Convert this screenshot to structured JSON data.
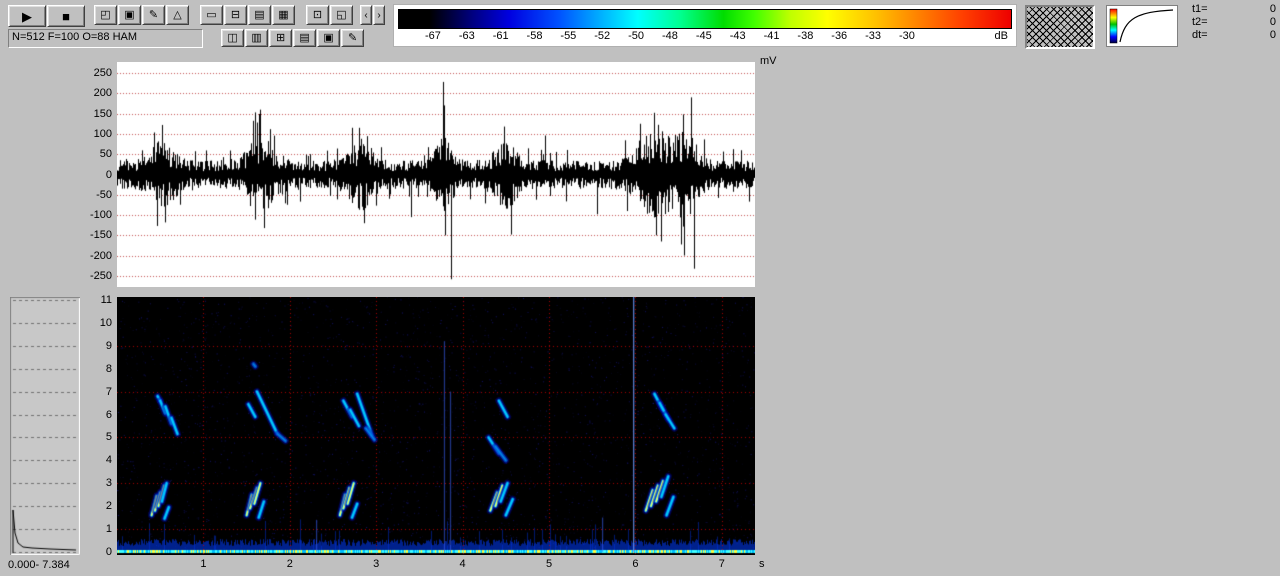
{
  "colors": {
    "background": "#c0c0c0",
    "grid_red": "#b43c3c",
    "spectro_grid": "#b40000",
    "accent_black": "#000000"
  },
  "toolbar": {
    "status_field": "N=512 F=100 O=88 HAM",
    "row1": [
      {
        "name": "play-button",
        "icon": "play-icon",
        "glyph": "▶",
        "big": true
      },
      {
        "name": "stop-button",
        "icon": "stop-icon",
        "glyph": "■",
        "big": true
      },
      {
        "gap": 8
      },
      {
        "name": "cascade-windows-button",
        "icon": "cascade-windows-icon",
        "glyph": "◰"
      },
      {
        "name": "save-button",
        "icon": "save-icon",
        "glyph": "▣"
      },
      {
        "name": "edit-button",
        "icon": "pencil-icon",
        "glyph": "✎"
      },
      {
        "name": "display-mode-button",
        "icon": "triangle-icon",
        "glyph": "△"
      },
      {
        "gap": 10
      },
      {
        "name": "window-layout-1-button",
        "icon": "window-single-icon",
        "glyph": "▭"
      },
      {
        "name": "window-layout-2-button",
        "icon": "window-hsplit-icon",
        "glyph": "⊟"
      },
      {
        "name": "window-layout-3-button",
        "icon": "window-rows-icon",
        "glyph": "▤"
      },
      {
        "name": "window-layout-4-button",
        "icon": "window-grid-icon",
        "glyph": "▦"
      },
      {
        "gap": 10
      },
      {
        "name": "print-button",
        "icon": "printer-icon",
        "glyph": "⊡"
      },
      {
        "name": "open-file-button",
        "icon": "folder-open-icon",
        "glyph": "◱"
      },
      {
        "gap": 6
      },
      {
        "name": "scroll-left-button",
        "icon": "chevron-left-icon",
        "glyph": "‹",
        "narrow": true
      },
      {
        "name": "scroll-right-button",
        "icon": "chevron-right-icon",
        "glyph": "›",
        "narrow": true
      }
    ],
    "row2_buttons": [
      {
        "name": "view-layout-1-button",
        "icon": "window-vsplit-icon",
        "glyph": "◫"
      },
      {
        "name": "view-layout-2-button",
        "icon": "window-hrows-icon",
        "glyph": "▥"
      },
      {
        "name": "view-layout-3-button",
        "icon": "window-plus-icon",
        "glyph": "⊞"
      },
      {
        "name": "view-layout-4-button",
        "icon": "window-lines-icon",
        "glyph": "▤"
      },
      {
        "name": "view-layout-5-button",
        "icon": "window-boxed-icon",
        "glyph": "▣"
      },
      {
        "name": "annotate-button",
        "icon": "note-icon",
        "glyph": "✎"
      }
    ]
  },
  "db_scale": {
    "labels": [
      "-67",
      "-63",
      "-61",
      "-58",
      "-55",
      "-52",
      "-50",
      "-48",
      "-45",
      "-43",
      "-41",
      "-38",
      "-36",
      "-33",
      "-30"
    ],
    "unit": "dB"
  },
  "time_panel": {
    "rows": [
      {
        "label": "t1=",
        "value": "0"
      },
      {
        "label": "t2=",
        "value": "0"
      },
      {
        "label": "dt=",
        "value": "0"
      }
    ]
  },
  "waveform_panel": {
    "unit": "mV",
    "y_ticks": [
      "250",
      "200",
      "150",
      "100",
      "50",
      "0",
      "-50",
      "-100",
      "-150",
      "-200",
      "-250"
    ]
  },
  "spectrogram_panel": {
    "y_ticks": [
      "11",
      "10",
      "9",
      "8",
      "7",
      "6",
      "5",
      "4",
      "3",
      "2",
      "1",
      "0"
    ],
    "x_ticks": [
      "1",
      "2",
      "3",
      "4",
      "5",
      "6",
      "7"
    ],
    "x_unit": "s"
  },
  "spectrum_panel": {
    "range_label": "0.000- 7.384"
  },
  "chart_data": {
    "type": "heatmap",
    "title": "",
    "duration_s": 7.384,
    "oscillogram": {
      "unit": "mV",
      "ylim": [
        -260,
        260
      ],
      "base_amplitude_mV": 32,
      "bursts": [
        [
          0.52,
          45,
          0.12
        ],
        [
          1.66,
          55,
          0.15
        ],
        [
          2.82,
          50,
          0.12
        ],
        [
          3.78,
          55,
          0.08
        ],
        [
          4.5,
          45,
          0.12
        ],
        [
          6.25,
          70,
          0.18
        ],
        [
          6.6,
          60,
          0.1
        ]
      ],
      "spikes": [
        [
          3.77,
          228
        ],
        [
          3.86,
          -258
        ],
        [
          3.8,
          -150
        ],
        [
          0.52,
          122
        ],
        [
          0.56,
          -118
        ],
        [
          1.62,
          128
        ],
        [
          1.7,
          -132
        ],
        [
          2.8,
          115
        ],
        [
          2.86,
          -120
        ],
        [
          4.48,
          118
        ],
        [
          4.56,
          -148
        ],
        [
          6.05,
          125
        ],
        [
          6.22,
          152
        ],
        [
          6.3,
          -165
        ],
        [
          6.55,
          148
        ],
        [
          6.64,
          190
        ],
        [
          6.68,
          -232
        ],
        [
          3.4,
          -105
        ],
        [
          4.95,
          96
        ],
        [
          5.55,
          -98
        ],
        [
          5.9,
          -90
        ]
      ]
    },
    "spectrogram": {
      "f_max_khz": 11,
      "noise_floor_khz": 0.4,
      "grid": {
        "x_every_s": 1,
        "y_lines_khz": [
          1,
          3,
          5,
          7,
          9
        ]
      },
      "strokes": [
        [
          0.47,
          6.8,
          0.5,
          6.6,
          1
        ],
        [
          0.5,
          6.6,
          0.56,
          6.05,
          1
        ],
        [
          0.56,
          6.35,
          0.63,
          5.6,
          1
        ],
        [
          0.63,
          5.85,
          0.7,
          5.15,
          1
        ],
        [
          0.4,
          1.6,
          0.46,
          2.45,
          2
        ],
        [
          0.44,
          1.8,
          0.5,
          2.6,
          2
        ],
        [
          0.48,
          2.0,
          0.545,
          2.9,
          2
        ],
        [
          0.52,
          2.2,
          0.575,
          3.0,
          1
        ],
        [
          0.55,
          1.45,
          0.6,
          1.95,
          1
        ],
        [
          1.52,
          6.45,
          1.6,
          5.9,
          1
        ],
        [
          1.58,
          8.2,
          1.6,
          8.1,
          0
        ],
        [
          1.62,
          7.0,
          1.85,
          5.2,
          1
        ],
        [
          1.86,
          5.15,
          1.95,
          4.85,
          0
        ],
        [
          1.5,
          1.6,
          1.56,
          2.5,
          2
        ],
        [
          1.54,
          1.9,
          1.62,
          2.8,
          2
        ],
        [
          1.59,
          2.1,
          1.66,
          3.0,
          2
        ],
        [
          1.64,
          1.5,
          1.7,
          2.2,
          1
        ],
        [
          2.62,
          6.6,
          2.72,
          5.9,
          1
        ],
        [
          2.7,
          6.2,
          2.8,
          5.5,
          1
        ],
        [
          2.78,
          6.9,
          2.95,
          5.1,
          1
        ],
        [
          2.88,
          5.4,
          2.98,
          4.9,
          0
        ],
        [
          2.58,
          1.6,
          2.64,
          2.5,
          2
        ],
        [
          2.62,
          1.9,
          2.69,
          2.8,
          2
        ],
        [
          2.67,
          2.1,
          2.74,
          3.0,
          2
        ],
        [
          2.72,
          1.5,
          2.78,
          2.1,
          1
        ],
        [
          4.42,
          6.6,
          4.52,
          5.9,
          1
        ],
        [
          4.3,
          5.0,
          4.42,
          4.3,
          1
        ],
        [
          4.38,
          4.6,
          4.5,
          4.0,
          0
        ],
        [
          4.32,
          1.8,
          4.4,
          2.6,
          2
        ],
        [
          4.38,
          2.0,
          4.46,
          2.9,
          2
        ],
        [
          4.44,
          2.2,
          4.52,
          3.0,
          1
        ],
        [
          4.5,
          1.6,
          4.58,
          2.3,
          1
        ],
        [
          6.22,
          6.9,
          6.32,
          6.2,
          1
        ],
        [
          6.28,
          6.5,
          6.38,
          5.8,
          1
        ],
        [
          6.35,
          6.0,
          6.45,
          5.4,
          1
        ],
        [
          6.12,
          1.8,
          6.2,
          2.7,
          2
        ],
        [
          6.18,
          2.0,
          6.26,
          2.9,
          2
        ],
        [
          6.24,
          2.2,
          6.32,
          3.1,
          2
        ],
        [
          6.3,
          2.4,
          6.38,
          3.3,
          1
        ],
        [
          6.36,
          1.6,
          6.44,
          2.4,
          1
        ]
      ],
      "impulses": [
        [
          2.31,
          1.4,
          0
        ],
        [
          5.62,
          1.5,
          0
        ],
        [
          5.98,
          11.2,
          1
        ],
        [
          3.79,
          9.2,
          0
        ],
        [
          3.86,
          7.0,
          0
        ]
      ]
    },
    "side_spectrum": {
      "points": [
        [
          3,
          256
        ],
        [
          3,
          213
        ],
        [
          5,
          236
        ],
        [
          8,
          246
        ],
        [
          13,
          250
        ],
        [
          22,
          251
        ],
        [
          40,
          252
        ],
        [
          66,
          253
        ]
      ]
    }
  }
}
